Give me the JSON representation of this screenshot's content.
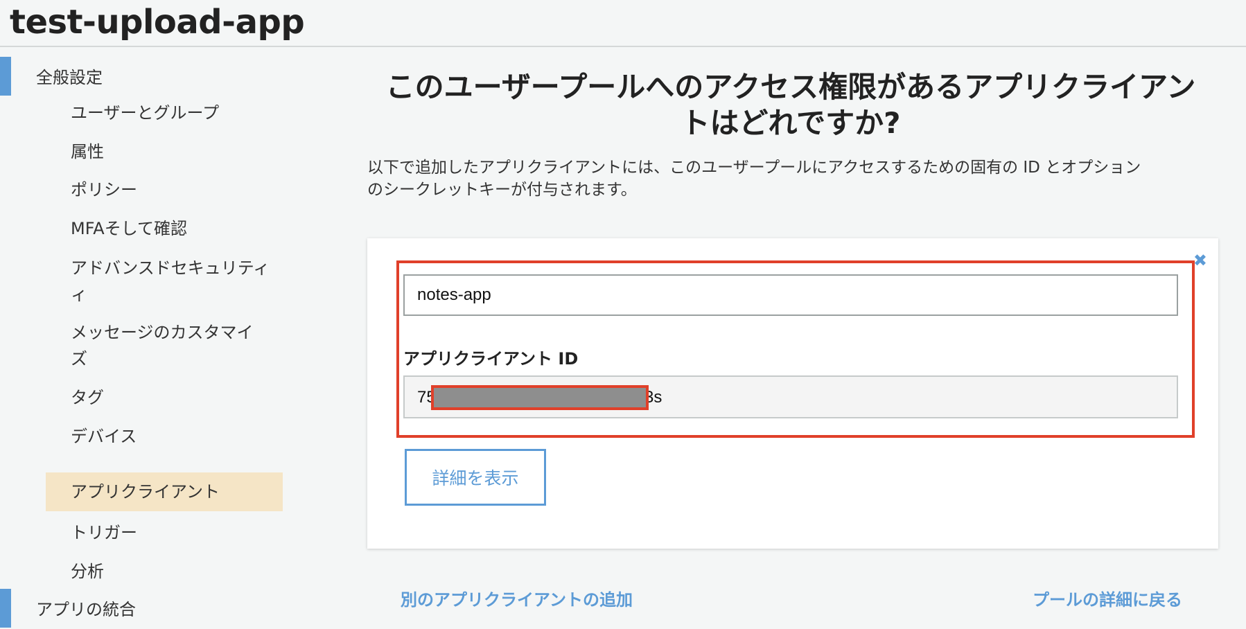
{
  "header": {
    "title": "test-upload-app"
  },
  "sidebar": {
    "section_general": "全般設定",
    "items": [
      "ユーザーとグループ",
      "属性",
      "ポリシー",
      "MFAそして確認",
      "アドバンスドセキュリティ",
      "ィ",
      "メッセージのカスタマイ",
      "ズ",
      "タグ",
      "デバイス",
      "アプリクライアント",
      "トリガー",
      "分析"
    ],
    "active_item": "アプリクライアント",
    "section_integration": "アプリの統合"
  },
  "main": {
    "heading_line1": "このユーザープールへのアクセス権限があるアプリクライアン",
    "heading_line2": "トはどれですか?",
    "description_line1": "以下で追加したアプリクライアントには、このユーザープールにアクセスするための固有の ID とオプション",
    "description_line2": "のシークレットキーが付与されます。",
    "client": {
      "name_value": "notes-app",
      "id_label": "アプリクライアント ID",
      "id_prefix": "75",
      "id_suffix": "3s",
      "details_button": "詳細を表示",
      "close_symbol": "✖"
    },
    "add_client_link": "別のアプリクライアントの追加",
    "back_link": "プールの詳細に戻る"
  },
  "colors": {
    "accent": "#5c9bd6",
    "highlight_border": "#e0402a",
    "active_nav": "#f5e5c6",
    "background": "#f4f6f6"
  }
}
